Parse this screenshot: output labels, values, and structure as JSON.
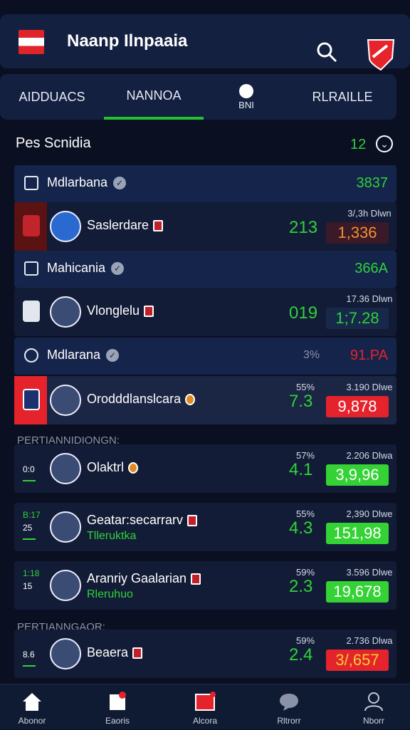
{
  "header": {
    "title": "Naanp Ilnpaaia"
  },
  "tabs": [
    {
      "label": "AIDDUACS"
    },
    {
      "label": "NANNOA"
    },
    {
      "label": "BNI"
    },
    {
      "label": "RLRAILLE"
    }
  ],
  "section": {
    "title": "Pes Scnidia",
    "count": "12"
  },
  "groups": [
    {
      "label": "Mdlarbana",
      "value": "3837"
    },
    {
      "label": "Mahicania",
      "value": "366A"
    },
    {
      "label": "Mdlarana",
      "value": "91.PA",
      "pct": "3%"
    }
  ],
  "rows": [
    {
      "name": "Saslerdare",
      "big": "213",
      "odds": "3/,3h Dlwn",
      "box": "1,336"
    },
    {
      "name": "Vlonglelu",
      "big": "019",
      "odds": "17.36 Dlwn",
      "box": "1;7.28"
    },
    {
      "name": "Orodddlanslcara",
      "big": "7.3",
      "pct": "55%",
      "odds": "3.190 Dlwe",
      "box": "9,878"
    },
    {
      "name": "Olaktrl",
      "big": "4.1",
      "pct": "57%",
      "odds": "2.206 Dlwa",
      "box": "3,9,96",
      "rank": "0:0"
    },
    {
      "name": "Geatar:secarrarv",
      "name2": "Tlleruktka",
      "big": "4.3",
      "pct": "55%",
      "odds": "2,390 Dlwe",
      "box": "151,98",
      "rank": "25",
      "rank_top": "B:17"
    },
    {
      "name": "Aranriy Gaalarian",
      "name2": "Rleruhuo",
      "big": "2.3",
      "pct": "59%",
      "odds": "3.596 Dlwe",
      "box": "19,678",
      "rank": "15",
      "rank_top": "1:18"
    },
    {
      "name": "Beaera",
      "big": "2.4",
      "pct": "59%",
      "odds": "2.736 Dlwa",
      "box": "3/,657",
      "rank": "8.6"
    }
  ],
  "sublabels": [
    "PERTIANNIDIONGN:",
    "PERTIANNGAOR:"
  ],
  "bottom": [
    "Abonor",
    "Eaoris",
    "Alcora",
    "Rltrorr",
    "Nborr"
  ]
}
